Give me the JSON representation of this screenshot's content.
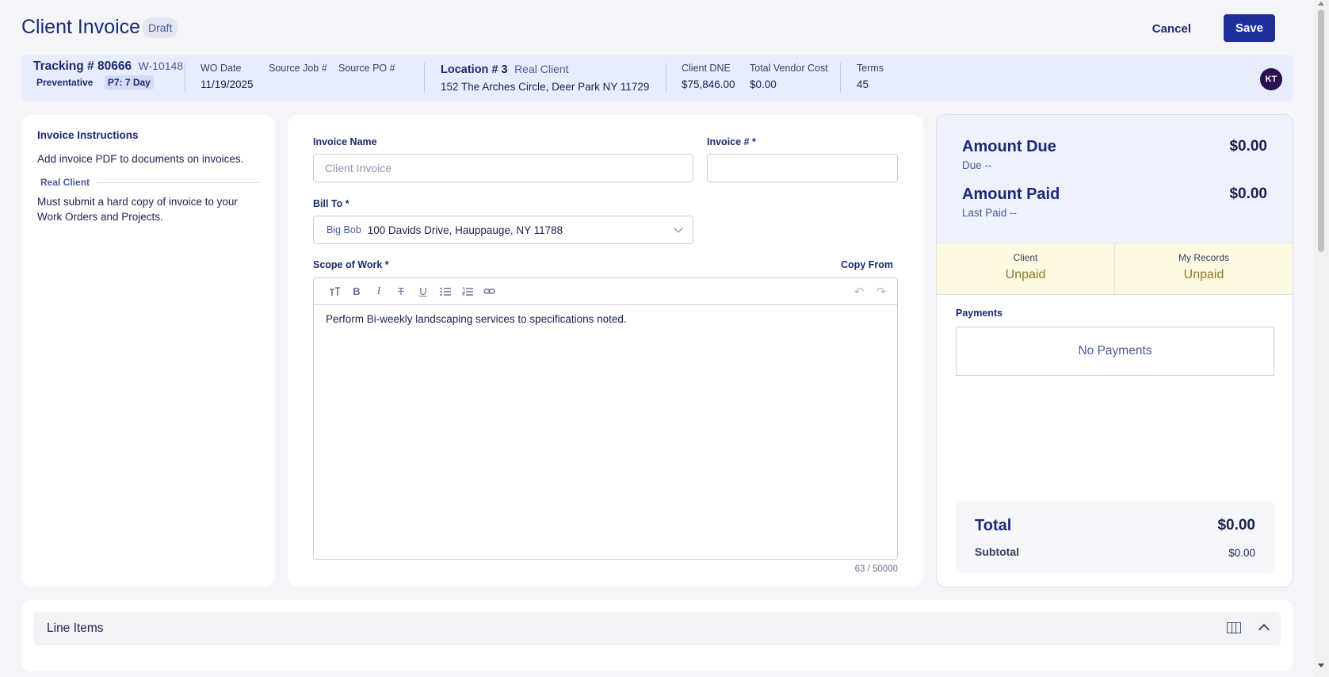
{
  "header": {
    "title": "Client Invoice",
    "status_badge": "Draft",
    "cancel_label": "Cancel",
    "save_label": "Save"
  },
  "summary": {
    "tracking_title": "Tracking # 80666",
    "wo_number": "W-10148",
    "type_tag": "Preventative",
    "priority_tag": "P7: 7 Day",
    "wo_date_label": "WO Date",
    "wo_date": "11/19/2025",
    "source_job_label": "Source Job #",
    "source_po_label": "Source PO #",
    "location_title": "Location # 3",
    "location_client": "Real Client",
    "location_address": "152 The Arches Circle, Deer Park NY 11729",
    "client_dne_label": "Client DNE",
    "client_dne": "$75,846.00",
    "vendor_cost_label": "Total Vendor Cost",
    "vendor_cost": "$0.00",
    "terms_label": "Terms",
    "terms": "45",
    "avatar_initials": "KT"
  },
  "instructions": {
    "title": "Invoice Instructions",
    "text": "Add invoice PDF to documents on invoices.",
    "client_label": "Real Client",
    "client_text": "Must submit a hard copy of invoice to your Work Orders and Projects."
  },
  "form": {
    "invoice_name_label": "Invoice Name",
    "invoice_name_placeholder": "Client Invoice",
    "invoice_number_label": "Invoice # *",
    "invoice_number_value": "",
    "bill_to_label": "Bill To *",
    "bill_to_name": "Big Bob",
    "bill_to_address": "100 Davids Drive, Hauppauge, NY 11788",
    "scope_label": "Scope of Work *",
    "copy_from_label": "Copy From",
    "scope_text": "Perform Bi-weekly landscaping services to specifications noted.",
    "char_counter": "63 / 50000"
  },
  "amounts": {
    "due_title": "Amount Due",
    "due_value": "$0.00",
    "due_sub": "Due --",
    "paid_title": "Amount Paid",
    "paid_value": "$0.00",
    "paid_sub": "Last Paid --",
    "client_status_label": "Client",
    "client_status": "Unpaid",
    "records_status_label": "My Records",
    "records_status": "Unpaid",
    "payments_label": "Payments",
    "no_payments": "No Payments",
    "total_label": "Total",
    "total_value": "$0.00",
    "subtotal_label": "Subtotal",
    "subtotal_value": "$0.00"
  },
  "line_items": {
    "title": "Line Items"
  },
  "icons": [
    "text-size-icon",
    "bold-icon",
    "italic-icon",
    "strikethrough-icon",
    "underline-icon",
    "bullet-list-icon",
    "numbered-list-icon",
    "link-icon",
    "undo-icon",
    "redo-icon",
    "columns-icon",
    "chevron-up-icon",
    "chevron-down-icon"
  ],
  "colors": {
    "primary": "#1e2f9c",
    "navy_text": "#1b2a72",
    "summary_bg": "#e8edfb",
    "status_bg": "#fdf9e0",
    "status_text": "#8a7a2a"
  }
}
